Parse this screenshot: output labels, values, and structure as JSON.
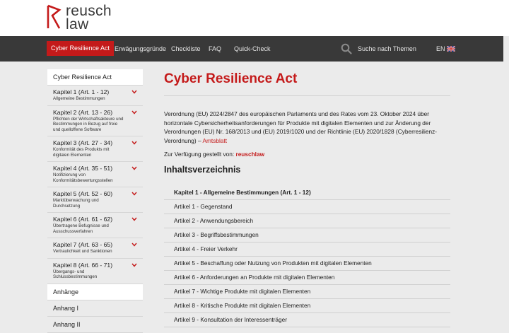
{
  "logo": {
    "line1": "reusch",
    "line2": "law"
  },
  "nav": {
    "items": [
      "Cyber Resilience Act",
      "Erwägungsgründe",
      "Checkliste",
      "FAQ",
      "Quick-Check"
    ],
    "search_placeholder": "Suche nach Themen",
    "lang": "EN"
  },
  "sidebar": {
    "header": "Cyber Resilience Act",
    "chapters": [
      {
        "title": "Kapitel 1 (Art. 1 - 12)",
        "subtitle": "Allgemeine Bestimmungen"
      },
      {
        "title": "Kapitel 2 (Art. 13 - 26)",
        "subtitle": "Pflichten der Wirtschaftsakteure und Bestimmungen in Bezug auf freie und quelloffene Software"
      },
      {
        "title": "Kapitel 3 (Art. 27 - 34)",
        "subtitle": "Konformität des Produkts mit digitalen Elementen"
      },
      {
        "title": "Kapitel 4 (Art. 35 - 51)",
        "subtitle": "Notifizierung von Konformitätsbewertungsstellen"
      },
      {
        "title": "Kapitel 5 (Art. 52 - 60)",
        "subtitle": "Marktüberwachung und Durchsetzung"
      },
      {
        "title": "Kapitel 6  (Art. 61 - 62)",
        "subtitle": "Übertragene Befugnisse und Ausschussverfahren"
      },
      {
        "title": "Kapitel 7 (Art. 63 - 65)",
        "subtitle": "Vertraulichkeit und Sanktionen"
      },
      {
        "title": "Kapitel 8 (Art. 66 - 71)",
        "subtitle": "Übergangs- und Schlussbestimmungen"
      }
    ],
    "annex_header": "Anhänge",
    "annexes": [
      "Anhang I",
      "Anhang II"
    ]
  },
  "main": {
    "title": "Cyber Resilience Act",
    "intro": "Verordnung (EU) 2024/2847 des europäischen Parlaments und des Rates vom 23. Oktober 2024 über horizontale Cybersicherheitsanforderungen für Produkte mit digitalen Elementen und zur Änderung der Verordnungen (EU) Nr. 168/2013 und (EU) 2019/1020 und der Richtlinie (EU) 2020/1828 (Cyberresilienz-Verordnung) – ",
    "intro_link": "Amtsblatt",
    "avail_label": "Zur Verfügung gestellt von: ",
    "avail_link": "reuschlaw",
    "toc_title": "Inhaltsverzeichnis",
    "toc": [
      "Kapitel 1  -  Allgemeine Bestimmungen (Art. 1 - 12)",
      "Artikel 1  -  Gegenstand",
      "Artikel 2  -  Anwendungsbereich",
      "Artikel 3  -  Begriffsbestimmungen",
      "Artikel 4  -  Freier Verkehr",
      "Artikel 5  -  Beschaffung oder Nutzung von Produkten mit digitalen Elementen",
      "Artikel 6  -  Anforderungen an Produkte mit digitalen Elementen",
      "Artikel 7  -  Wichtige Produkte mit digitalen Elementen",
      "Artikel 8  -  Kritische Produkte mit digitalen Elementen",
      "Artikel 9  -  Konsultation der Interessenträger"
    ]
  },
  "colors": {
    "accent": "#c41a1a",
    "nav_bg": "#393939",
    "page_bg": "#ebebeb"
  }
}
